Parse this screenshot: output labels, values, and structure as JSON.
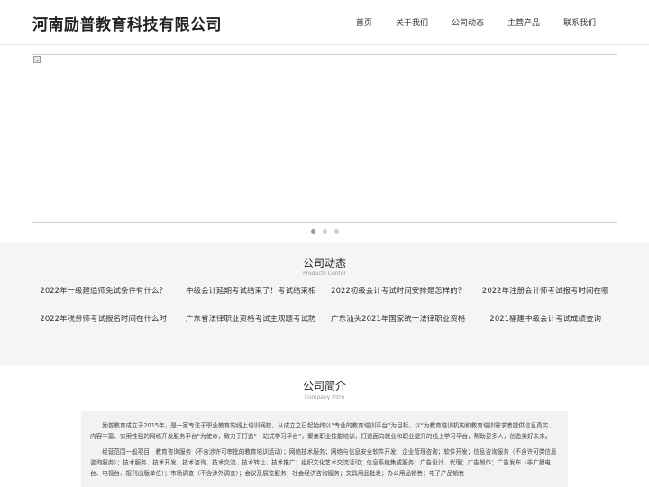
{
  "header": {
    "logo": "河南励普教育科技有限公司",
    "nav": [
      "首页",
      "关于我们",
      "公司动态",
      "主营产品",
      "联系我们"
    ]
  },
  "banner": {
    "slides": 3,
    "active_slide": 1
  },
  "news": {
    "title": "公司动态",
    "subtitle": "Products Center",
    "items": [
      "2022年一级建造师免试条件有什么？",
      "中级会计延期考试结束了！考试结束相",
      "2022初级会计考试时间安排是怎样的？",
      "2022年注册会计师考试报考时间在哪",
      "2022年税务师考试报名时间在什么时",
      "广东省法律职业资格考试主观题考试防",
      "广东汕头2021年国家统一法律职业资格",
      "2021福建中级会计考试成绩查询"
    ]
  },
  "about": {
    "title": "公司简介",
    "subtitle": "Company Intro",
    "paragraphs": [
      "励普教育成立于2015年，是一家专注于职业教育的线上培训网校，从成立之日起始终以“专业的教育培训平台”为目标，以“为教育培训机构和教育培训需求者提供信息真实、内容丰富、实用性强的网络开发服务平台”为使命，致力于打造“一站式学习平台”，聚集职业技能培训，打造面向就业和职业提升的线上学习平台，帮助更多人，创造美好未来。",
      "经营范围一般项目：教育咨询服务（不含涉许可审批的教育培训活动）；网络技术服务；网络与信息安全软件开发；企业管理咨询；软件开发；信息咨询服务（不含许可类信息咨询服务）；技术服务、技术开发、技术咨询、技术交流、技术转让、技术推广；组织文化艺术交流活动；信息系统集成服务；广告设计、代理；广告制作；广告发布（非广播电台、电视台、报刊出版单位）；市场调查（不含涉外调查）；会议及展览服务；社会经济咨询服务；文具用品批发；办公用品销售；电子产品销售"
    ]
  }
}
